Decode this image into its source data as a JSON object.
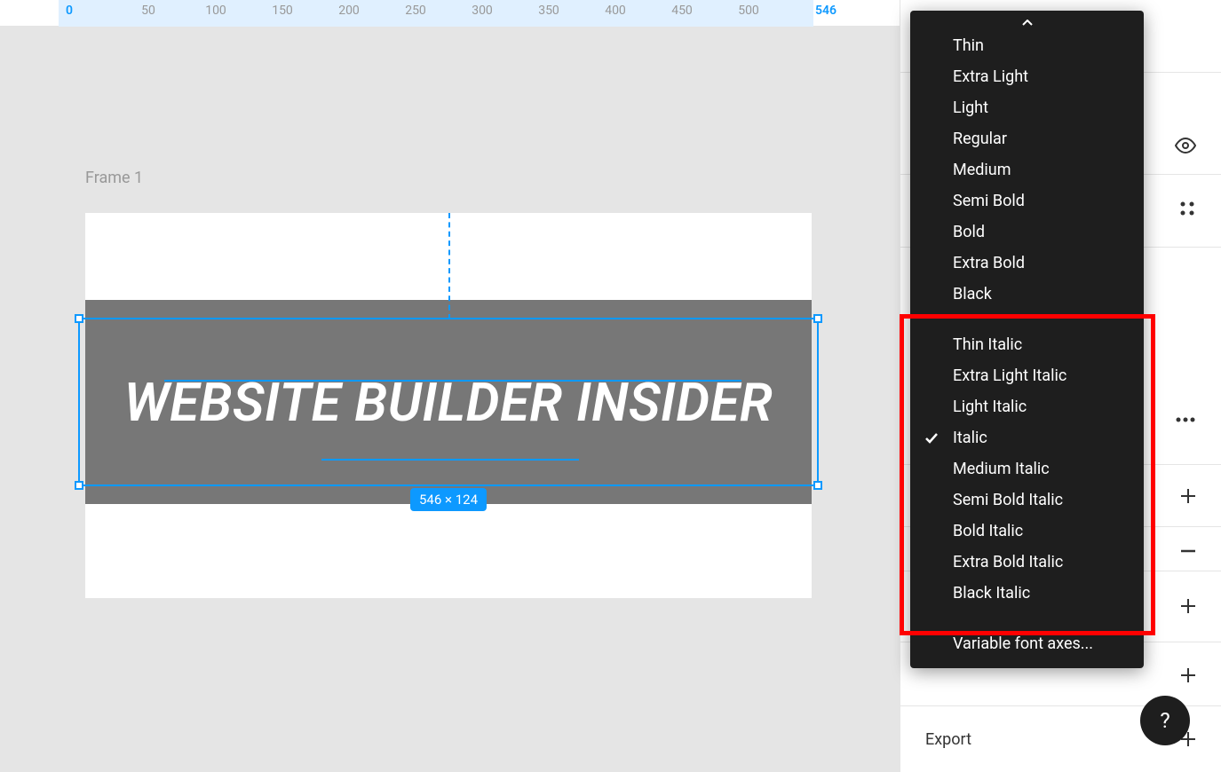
{
  "ruler": {
    "marks": [
      {
        "label": "0",
        "pos": 78,
        "active": true
      },
      {
        "label": "50",
        "pos": 167,
        "active": false
      },
      {
        "label": "100",
        "pos": 243,
        "active": false
      },
      {
        "label": "150",
        "pos": 318,
        "active": false
      },
      {
        "label": "200",
        "pos": 393,
        "active": false
      },
      {
        "label": "250",
        "pos": 468,
        "active": false
      },
      {
        "label": "300",
        "pos": 543,
        "active": false
      },
      {
        "label": "350",
        "pos": 618,
        "active": false
      },
      {
        "label": "400",
        "pos": 693,
        "active": false
      },
      {
        "label": "450",
        "pos": 768,
        "active": false
      },
      {
        "label": "500",
        "pos": 843,
        "active": false
      },
      {
        "label": "546",
        "pos": 930,
        "active": true
      }
    ]
  },
  "canvas": {
    "frame_label": "Frame 1",
    "text_content": "WEBSITE BUILDER INSIDER",
    "selection_dimensions": "546 × 124"
  },
  "dropdown": {
    "items_top": [
      "Thin",
      "Extra Light",
      "Light",
      "Regular",
      "Medium",
      "Semi Bold",
      "Bold",
      "Extra Bold",
      "Black"
    ],
    "items_italic": [
      "Thin Italic",
      "Extra Light Italic",
      "Light Italic",
      "Italic",
      "Medium Italic",
      "Semi Bold Italic",
      "Bold Italic",
      "Extra Bold Italic",
      "Black Italic"
    ],
    "selected": "Italic",
    "variable_axes": "Variable font axes..."
  },
  "panel": {
    "export_label": "Export"
  },
  "help_label": "?"
}
